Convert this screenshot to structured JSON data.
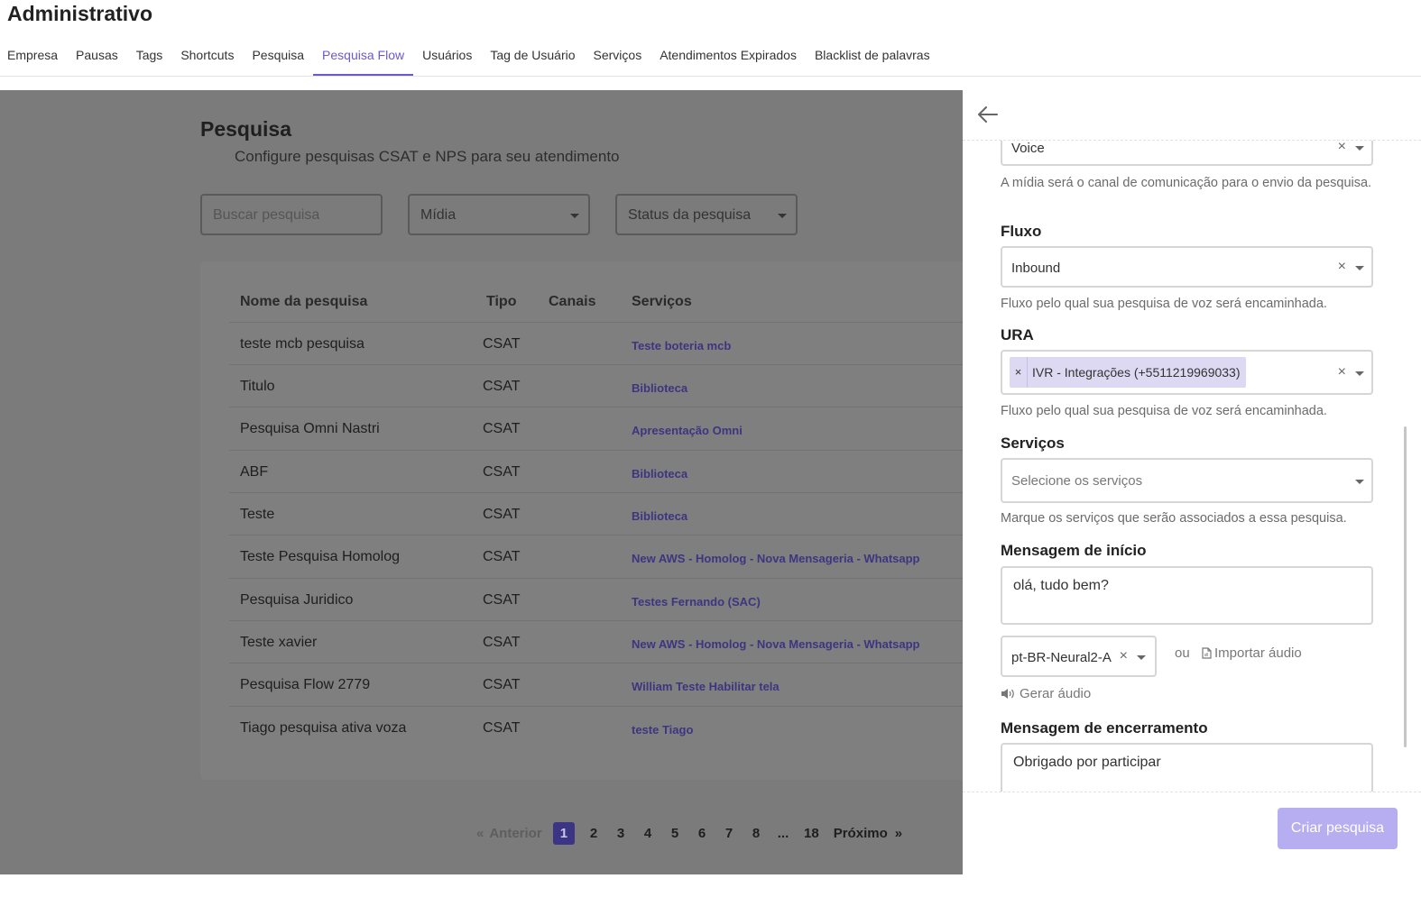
{
  "app": {
    "title": "Administrativo"
  },
  "tabs": [
    {
      "label": "Empresa",
      "active": false
    },
    {
      "label": "Pausas",
      "active": false
    },
    {
      "label": "Tags",
      "active": false
    },
    {
      "label": "Shortcuts",
      "active": false
    },
    {
      "label": "Pesquisa",
      "active": false
    },
    {
      "label": "Pesquisa Flow",
      "active": true
    },
    {
      "label": "Usuários",
      "active": false
    },
    {
      "label": "Tag de Usuário",
      "active": false
    },
    {
      "label": "Serviços",
      "active": false
    },
    {
      "label": "Atendimentos Expirados",
      "active": false
    },
    {
      "label": "Blacklist de palavras",
      "active": false
    }
  ],
  "page": {
    "heading": "Pesquisa",
    "subtitle": "Configure pesquisas CSAT e NPS para seu atendimento",
    "filters": {
      "search_placeholder": "Buscar pesquisa",
      "media": "Mídia",
      "status": "Status da pesquisa"
    },
    "table": {
      "headers": {
        "name": "Nome da pesquisa",
        "type": "Tipo",
        "channels": "Canais",
        "services": "Serviços"
      },
      "rows": [
        {
          "name": "teste mcb pesquisa",
          "type": "CSAT",
          "service": "Teste boteria mcb"
        },
        {
          "name": "Titulo",
          "type": "CSAT",
          "service": "Biblioteca"
        },
        {
          "name": "Pesquisa Omni Nastri",
          "type": "CSAT",
          "service": "Apresentação Omni"
        },
        {
          "name": "ABF",
          "type": "CSAT",
          "service": "Biblioteca"
        },
        {
          "name": "Teste",
          "type": "CSAT",
          "service": "Biblioteca"
        },
        {
          "name": "Teste Pesquisa Homolog",
          "type": "CSAT",
          "service": "New AWS - Homolog - Nova Mensageria - Whatsapp"
        },
        {
          "name": "Pesquisa Juridico",
          "type": "CSAT",
          "service": "Testes Fernando (SAC)"
        },
        {
          "name": "Teste xavier",
          "type": "CSAT",
          "service": "New AWS - Homolog - Nova Mensageria - Whatsapp"
        },
        {
          "name": "Pesquisa Flow 2779",
          "type": "CSAT",
          "service": "William Teste Habilitar tela"
        },
        {
          "name": "Tiago pesquisa ativa voza",
          "type": "CSAT",
          "service": "teste Tiago"
        }
      ]
    },
    "pagination": {
      "prev_arrows": "«",
      "prev_label": "Anterior",
      "pages": [
        "1",
        "2",
        "3",
        "4",
        "5",
        "6",
        "7",
        "8",
        "...",
        "18"
      ],
      "current": "1",
      "next_label": "Próximo",
      "next_arrows": "»"
    }
  },
  "panel": {
    "media": {
      "value": "Voice",
      "clear": "×",
      "hint": "A mídia será o canal de comunicação para o envio da pesquisa."
    },
    "flow": {
      "label": "Fluxo",
      "value": "Inbound",
      "clear": "×",
      "hint": "Fluxo pelo qual sua pesquisa de voz será encaminhada."
    },
    "ura": {
      "label": "URA",
      "tag": "IVR - Integrações (+5511219969033)",
      "tag_remove": "×",
      "clear": "×",
      "hint": "Fluxo pelo qual sua pesquisa de voz será encaminhada."
    },
    "services": {
      "label": "Serviços",
      "placeholder": "Selecione os serviços",
      "hint": "Marque os serviços que serão associados a essa pesquisa."
    },
    "start_message": {
      "label": "Mensagem de início",
      "value": "olá, tudo bem?"
    },
    "voice": {
      "value": "pt-BR-Neural2-A",
      "clear": "×"
    },
    "or_text": "ou",
    "import_audio": "Importar áudio",
    "generate_audio": "Gerar áudio",
    "end_message": {
      "label": "Mensagem de encerramento",
      "value": "Obrigado por participar"
    },
    "create_button": "Criar pesquisa"
  },
  "colors": {
    "accent": "#6a5acd",
    "button": "#b7adf1",
    "overlay": "#7b7b7b"
  }
}
